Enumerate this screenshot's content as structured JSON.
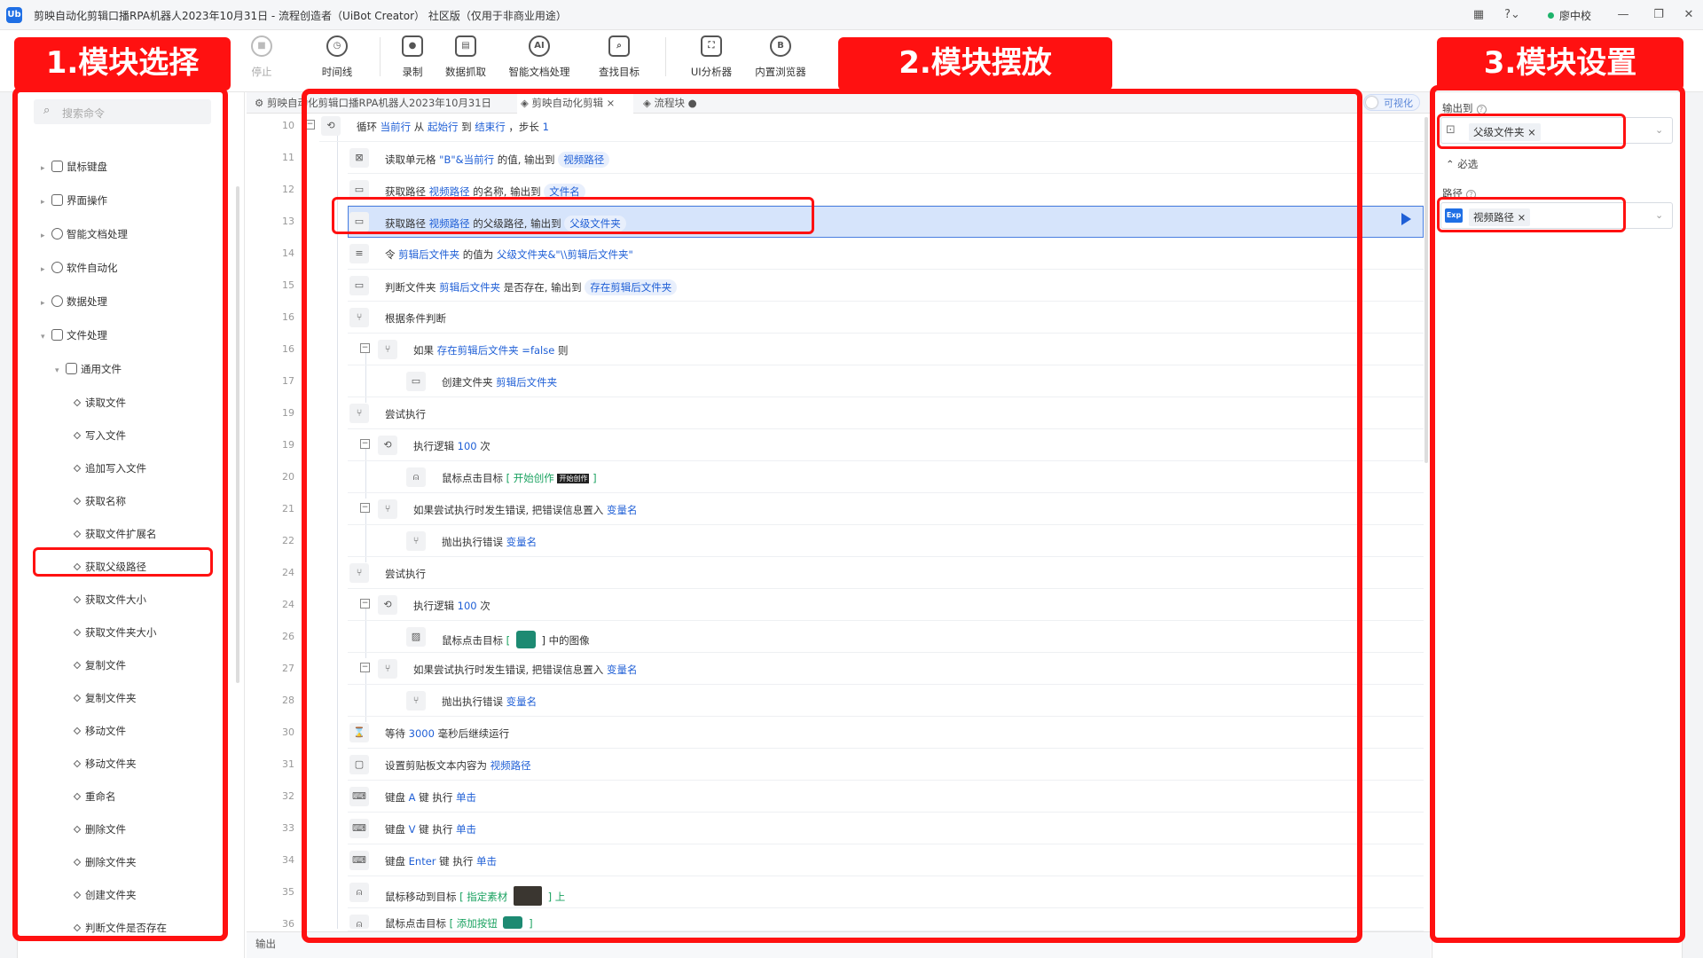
{
  "window": {
    "title": "剪映自动化剪辑口播RPA机器人2023年10月31日 - 流程创造者（UiBot Creator） 社区版（仅用于非商业用途）",
    "logo_text": "Ub",
    "user": "廖中校"
  },
  "toolbar": {
    "stop": "停止",
    "timeline": "时间线",
    "record": "录制",
    "data_scrape": "数据抓取",
    "smart_doc": "智能文档处理",
    "find_target": "查找目标",
    "ui_analyzer": "UI分析器",
    "browser": "内置浏览器"
  },
  "left": {
    "search_placeholder": "搜索命令",
    "categories": [
      "鼠标键盘",
      "界面操作",
      "智能文档处理",
      "软件自动化",
      "数据处理",
      "文件处理"
    ],
    "subcategory": "通用文件",
    "items": [
      "读取文件",
      "写入文件",
      "追加写入文件",
      "获取名称",
      "获取文件扩展名",
      "获取父级路径",
      "获取文件大小",
      "获取文件夹大小",
      "复制文件",
      "复制文件夹",
      "移动文件",
      "移动文件夹",
      "重命名",
      "删除文件",
      "删除文件夹",
      "创建文件夹",
      "判断文件是否存在"
    ]
  },
  "tabs": {
    "main": "剪映自动化剪辑口播RPA机器人2023年10月31日",
    "active": "剪映自动化剪辑",
    "flow": "流程块",
    "visual": "可视化"
  },
  "lines": {
    "l10": "10",
    "l11": "11",
    "l12": "12",
    "l13": "13",
    "l14": "14",
    "l15": "15",
    "l16a": "16",
    "l16b": "16",
    "l17": "17",
    "l19a": "19",
    "l19b": "19",
    "l20": "20",
    "l21": "21",
    "l22": "22",
    "l24a": "24",
    "l24b": "24",
    "l26": "26",
    "l27": "27",
    "l28": "28",
    "l30": "30",
    "l31": "31",
    "l32": "32",
    "l33": "33",
    "l34": "34",
    "l35": "35",
    "l36": "36"
  },
  "code": {
    "loop": {
      "a": "循环 ",
      "b": "当前行",
      "c": " 从 ",
      "d": "起始行",
      "e": " 到 ",
      "f": "结束行",
      "g": " ，步长 ",
      "h": "1"
    },
    "read_cell": {
      "a": "读取单元格 ",
      "b": "\"B\"&当前行",
      "c": " 的值, 输出到 ",
      "d": "视频路径"
    },
    "get_name": {
      "a": "获取路径 ",
      "b": "视频路径",
      "c": " 的名称, 输出到 ",
      "d": "文件名"
    },
    "get_parent": {
      "a": "获取路径 ",
      "b": "视频路径",
      "c": " 的父级路径, 输出到 ",
      "d": "父级文件夹"
    },
    "assign": {
      "a": "令 ",
      "b": "剪辑后文件夹",
      "c": " 的值为 ",
      "d": "父级文件夹&\"\\\\剪辑后文件夹\""
    },
    "exists": {
      "a": "判断文件夹 ",
      "b": "剪辑后文件夹",
      "c": " 是否存在, 输出到 ",
      "d": "存在剪辑后文件夹"
    },
    "cond": "根据条件判断",
    "if": {
      "a": "如果 ",
      "b": "存在剪辑后文件夹",
      "c": " =false",
      "d": " 则"
    },
    "mkdir": {
      "a": "创建文件夹 ",
      "b": "剪辑后文件夹"
    },
    "try1": "尝试执行",
    "retry1": {
      "a": "执行逻辑 ",
      "b": "100",
      "c": " 次"
    },
    "click1": {
      "a": "鼠标点击目标 ",
      "b": "[ 开始创作 ",
      "tag": "开始创作",
      "c": " ]"
    },
    "iferr1": {
      "a": "如果尝试执行时发生错误, 把错误信息置入 ",
      "b": "变量名"
    },
    "throw1": {
      "a": "抛出执行错误 ",
      "b": "变量名"
    },
    "try2": "尝试执行",
    "retry2": {
      "a": "执行逻辑 ",
      "b": "100",
      "c": " 次"
    },
    "click2": {
      "a": "鼠标点击目标 ",
      "b": "[ ",
      "c": " ] 中的图像"
    },
    "iferr2": {
      "a": "如果尝试执行时发生错误, 把错误信息置入 ",
      "b": "变量名"
    },
    "throw2": {
      "a": "抛出执行错误 ",
      "b": "变量名"
    },
    "wait": {
      "a": "等待 ",
      "b": "3000",
      "c": " 毫秒后继续运行"
    },
    "clip": {
      "a": "设置剪贴板文本内容为 ",
      "b": "视频路径"
    },
    "keyA": {
      "a": "键盘 ",
      "b": "A",
      "c": " 键 执行 ",
      "d": "单击"
    },
    "keyV": {
      "a": "键盘 ",
      "b": "V",
      "c": " 键 执行 ",
      "d": "单击"
    },
    "keyEnter": {
      "a": "键盘 ",
      "b": "Enter",
      "c": " 键 执行 ",
      "d": "单击"
    },
    "move": {
      "a": "鼠标移动到目标 ",
      "b": "[ 指定素材 ",
      "c": " ] 上"
    },
    "click3": {
      "a": "鼠标点击目标 ",
      "b": "[ 添加按钮 ",
      "c": " ]"
    }
  },
  "bottom": {
    "output": "输出"
  },
  "right": {
    "output_label": "输出到",
    "output_value": "父级文件夹",
    "required": "必选",
    "path_label": "路径",
    "path_badge": "Exp",
    "path_value": "视频路径"
  },
  "annotations": {
    "b1": "1.模块选择",
    "b2": "2.模块摆放",
    "b3": "3.模块设置",
    "color": "#ff1111"
  },
  "colors": {
    "variable": "#1f5fd6",
    "target": "#1aa260",
    "selected_row": "#d6e4fb"
  }
}
